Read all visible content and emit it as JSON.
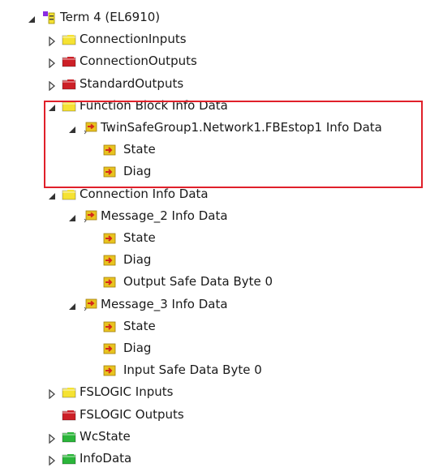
{
  "tree": {
    "nodes": [
      {
        "label": "Term 4 (EL6910)",
        "level": 0,
        "expander": "expanded",
        "icon": "terminal-icon"
      },
      {
        "label": "ConnectionInputs",
        "level": 1,
        "expander": "collapsed",
        "icon": "input-folder-icon"
      },
      {
        "label": "ConnectionOutputs",
        "level": 1,
        "expander": "collapsed",
        "icon": "output-folder-icon"
      },
      {
        "label": "StandardOutputs",
        "level": 1,
        "expander": "collapsed",
        "icon": "output-folder-icon"
      },
      {
        "label": "Function Block Info Data",
        "level": 1,
        "expander": "expanded",
        "icon": "input-folder-icon"
      },
      {
        "label": "TwinSafeGroup1.Network1.FBEstop1 Info Data",
        "level": 2,
        "expander": "expanded",
        "icon": "variable-group-icon"
      },
      {
        "label": "State",
        "level": 3,
        "expander": "none",
        "icon": "input-variable-icon"
      },
      {
        "label": "Diag",
        "level": 3,
        "expander": "none",
        "icon": "input-variable-icon"
      },
      {
        "label": "Connection Info Data",
        "level": 1,
        "expander": "expanded",
        "icon": "input-folder-icon"
      },
      {
        "label": "Message_2 Info Data",
        "level": 2,
        "expander": "expanded",
        "icon": "variable-group-icon"
      },
      {
        "label": "State",
        "level": 3,
        "expander": "none",
        "icon": "input-variable-icon"
      },
      {
        "label": "Diag",
        "level": 3,
        "expander": "none",
        "icon": "input-variable-icon"
      },
      {
        "label": "Output Safe Data Byte 0",
        "level": 3,
        "expander": "none",
        "icon": "input-variable-icon"
      },
      {
        "label": "Message_3 Info Data",
        "level": 2,
        "expander": "expanded",
        "icon": "variable-group-icon"
      },
      {
        "label": "State",
        "level": 3,
        "expander": "none",
        "icon": "input-variable-icon"
      },
      {
        "label": "Diag",
        "level": 3,
        "expander": "none",
        "icon": "input-variable-icon"
      },
      {
        "label": "Input Safe Data Byte 0",
        "level": 3,
        "expander": "none",
        "icon": "input-variable-icon"
      },
      {
        "label": "FSLOGIC Inputs",
        "level": 1,
        "expander": "collapsed",
        "icon": "input-folder-icon"
      },
      {
        "label": "FSLOGIC Outputs",
        "level": 1,
        "expander": "none",
        "icon": "output-folder-icon"
      },
      {
        "label": "WcState",
        "level": 1,
        "expander": "collapsed",
        "icon": "status-folder-icon"
      },
      {
        "label": "InfoData",
        "level": 1,
        "expander": "collapsed",
        "icon": "status-folder-icon"
      }
    ]
  },
  "colors": {
    "highlight": "#e0202a",
    "input_folder": "#f5e233",
    "output_folder": "#cc2027",
    "status_folder": "#2bb53a",
    "variable": "#e8c31f",
    "variable_arrow": "#d42a1a",
    "terminal": "#8a2be2"
  }
}
